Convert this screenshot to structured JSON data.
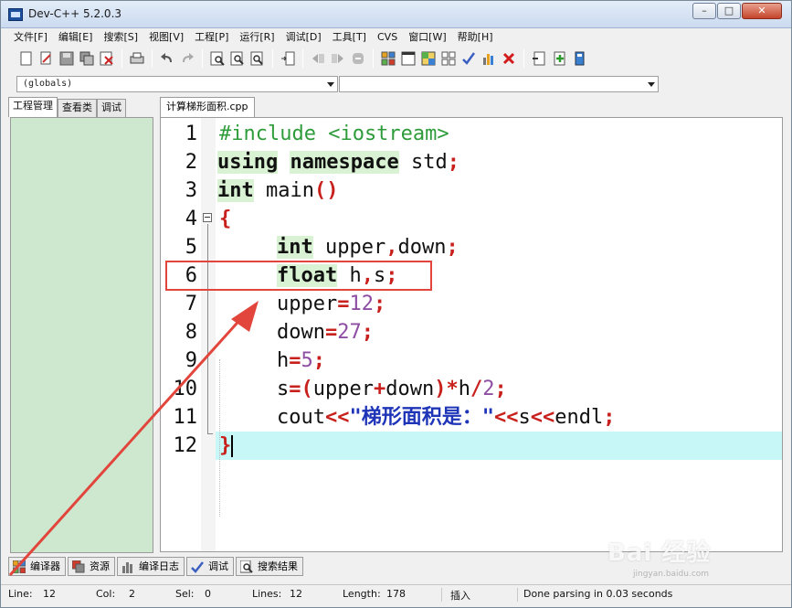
{
  "window": {
    "title": "Dev-C++ 5.2.0.3"
  },
  "menu": [
    "文件[F]",
    "编辑[E]",
    "搜索[S]",
    "视图[V]",
    "工程[P]",
    "运行[R]",
    "调试[D]",
    "工具[T]",
    "CVS",
    "窗口[W]",
    "帮助[H]"
  ],
  "combos": {
    "scope": "(globals)",
    "members": ""
  },
  "left_tabs": [
    "工程管理",
    "查看类",
    "调试"
  ],
  "editor": {
    "tab": "计算梯形面积.cpp",
    "line_numbers": [
      "1",
      "2",
      "3",
      "4",
      "5",
      "6",
      "7",
      "8",
      "9",
      "10",
      "11",
      "12"
    ]
  },
  "code": {
    "l1": "#include <iostream>",
    "l2_kw1": "using",
    "l2_kw2": "namespace",
    "l2_rest": " std",
    "l2_op": ";",
    "l3_kw": "int",
    "l3_id": " main",
    "l3_op": "()",
    "l4_op": "{",
    "l5_kw": "int",
    "l5_id": " upper",
    "l5_op1": ",",
    "l5_id2": "down",
    "l5_op2": ";",
    "l6_kw": "float",
    "l6_id": " h",
    "l6_op1": ",",
    "l6_id2": "s",
    "l6_op2": ";",
    "l7_id": "upper",
    "l7_op": "=",
    "l7_num": "12",
    "l7_end": ";",
    "l8_id": "down",
    "l8_op": "=",
    "l8_num": "27",
    "l8_end": ";",
    "l9_id": "h",
    "l9_op": "=",
    "l9_num": "5",
    "l9_end": ";",
    "l10_id1": "s",
    "l10_op1": "=(",
    "l10_id2": "upper",
    "l10_op2": "+",
    "l10_id3": "down",
    "l10_op3": ")*",
    "l10_id4": "h",
    "l10_op4": "/",
    "l10_num": "2",
    "l10_end": ";",
    "l11_id1": "cout",
    "l11_op1": "<<",
    "l11_str": "\"梯形面积是：\"",
    "l11_op2": "<<",
    "l11_id2": "s",
    "l11_op3": "<<",
    "l11_id3": "endl",
    "l11_end": ";",
    "l12_op": "}"
  },
  "bottom_tabs": [
    "编译器",
    "资源",
    "编译日志",
    "调试",
    "搜索结果"
  ],
  "status": {
    "line_label": "Line:",
    "line_val": "12",
    "col_label": "Col:",
    "col_val": "2",
    "sel_label": "Sel:",
    "sel_val": "0",
    "lines_label": "Lines:",
    "lines_val": "12",
    "length_label": "Length:",
    "length_val": "178",
    "mode": "插入",
    "message": "Done parsing in 0.03 seconds"
  },
  "watermark": {
    "brand": "Bai 经验",
    "url": "jingyan.baidu.com"
  },
  "colors": {
    "current_line": "#c8f7f8",
    "left_panel": "#cde8cf",
    "annotation": "#e2453c"
  }
}
